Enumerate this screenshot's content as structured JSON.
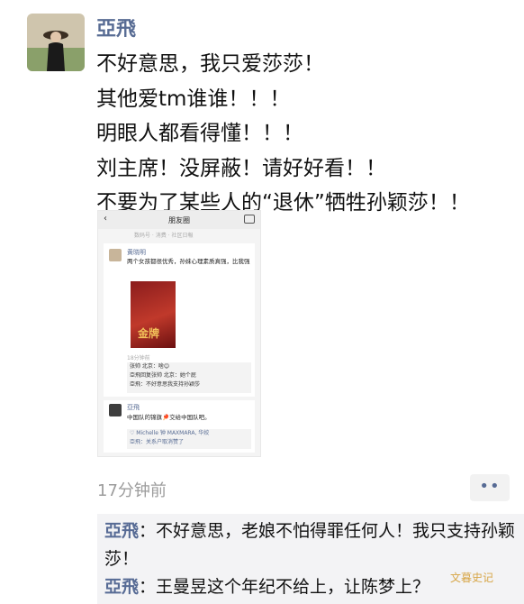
{
  "post": {
    "username": "亞飛",
    "lines": [
      "不好意思，我只爱莎莎！",
      "其他爱tm谁谁！！！",
      "明眼人都看得懂！！！",
      "刘主席！没屏蔽！请好好看！！",
      "不要为了某些人的“退休”牺牲孙颖莎！！"
    ],
    "time": "17分钟前"
  },
  "embedded_screenshot": {
    "title": "朋友圈",
    "subbar": "数码号 · 消费 · 社区日報",
    "author": "黄晓明",
    "text": "两个女孩都很优秀，孙妹心理素质真强，比我强",
    "photo_caption": "金牌",
    "time": "18分钟前",
    "comments": [
      "张帅 北京：啥😊",
      "亞飛回复张帅 北京：她个屁",
      "亞飛：不好意思我支持孙颖莎"
    ],
    "reply_author": "亞飛",
    "reply_text": "中国队的锦旗🏓交给中国队吧。",
    "likes": [
      "♡ Michelle 钟 MAXMARA, 华姣",
      "亞飛：关系户取消赞了"
    ]
  },
  "comments": [
    {
      "name": "亞飛",
      "text": "：不好意思，老娘不怕得罪任何人！我只支持孙颖莎！"
    },
    {
      "name": "亞飛",
      "text": "：王曼昱这个年纪不给上，让陈梦上？"
    }
  ],
  "watermark": "文暮史记",
  "colors": {
    "name": "#576b95",
    "comment_bg": "#f3f3f5",
    "time": "#9c9c9c"
  }
}
